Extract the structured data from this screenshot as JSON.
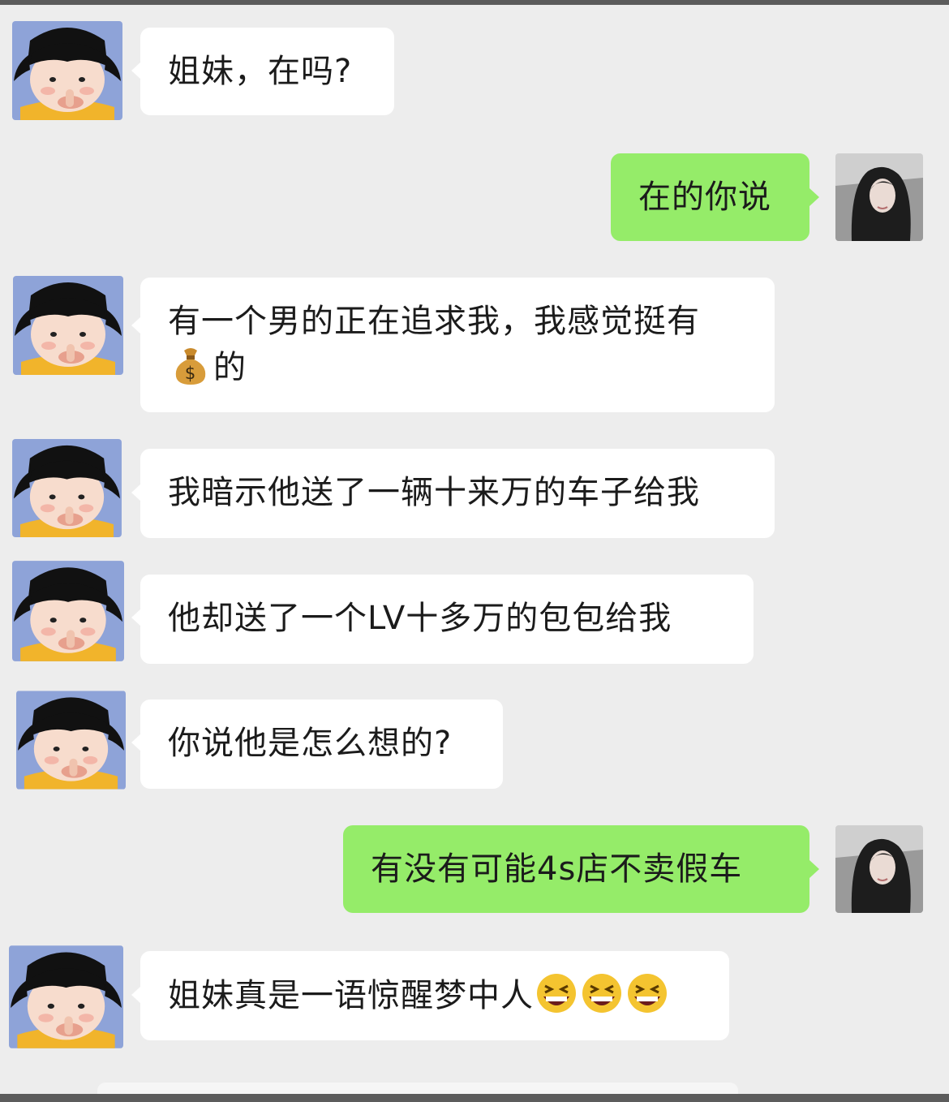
{
  "chat": {
    "messages": [
      {
        "side": "in",
        "text": "姐妹，在吗?"
      },
      {
        "side": "out",
        "text": "在的你说"
      },
      {
        "side": "in",
        "text_line1": "有一个男的正在追求我，我感觉挺有",
        "emoji": "money-bag",
        "text_after_emoji": "的"
      },
      {
        "side": "in",
        "text": "我暗示他送了一辆十来万的车子给我"
      },
      {
        "side": "in",
        "text": "他却送了一个LV十多万的包包给我"
      },
      {
        "side": "in",
        "text": "你说他是怎么想的?"
      },
      {
        "side": "out",
        "text": "有没有可能4s店不卖假车"
      },
      {
        "side": "in",
        "text": "姐妹真是一语惊醒梦中人",
        "emoji": "laughing-face",
        "emoji_count": 3
      }
    ]
  },
  "colors": {
    "background": "#ededed",
    "incoming_bubble": "#ffffff",
    "outgoing_bubble": "#95ec69",
    "avatar_background": "#8ea3d8"
  },
  "icons": {
    "contact_avatar": "cartoon-girl-avatar",
    "self_avatar": "photo-girl-avatar"
  }
}
